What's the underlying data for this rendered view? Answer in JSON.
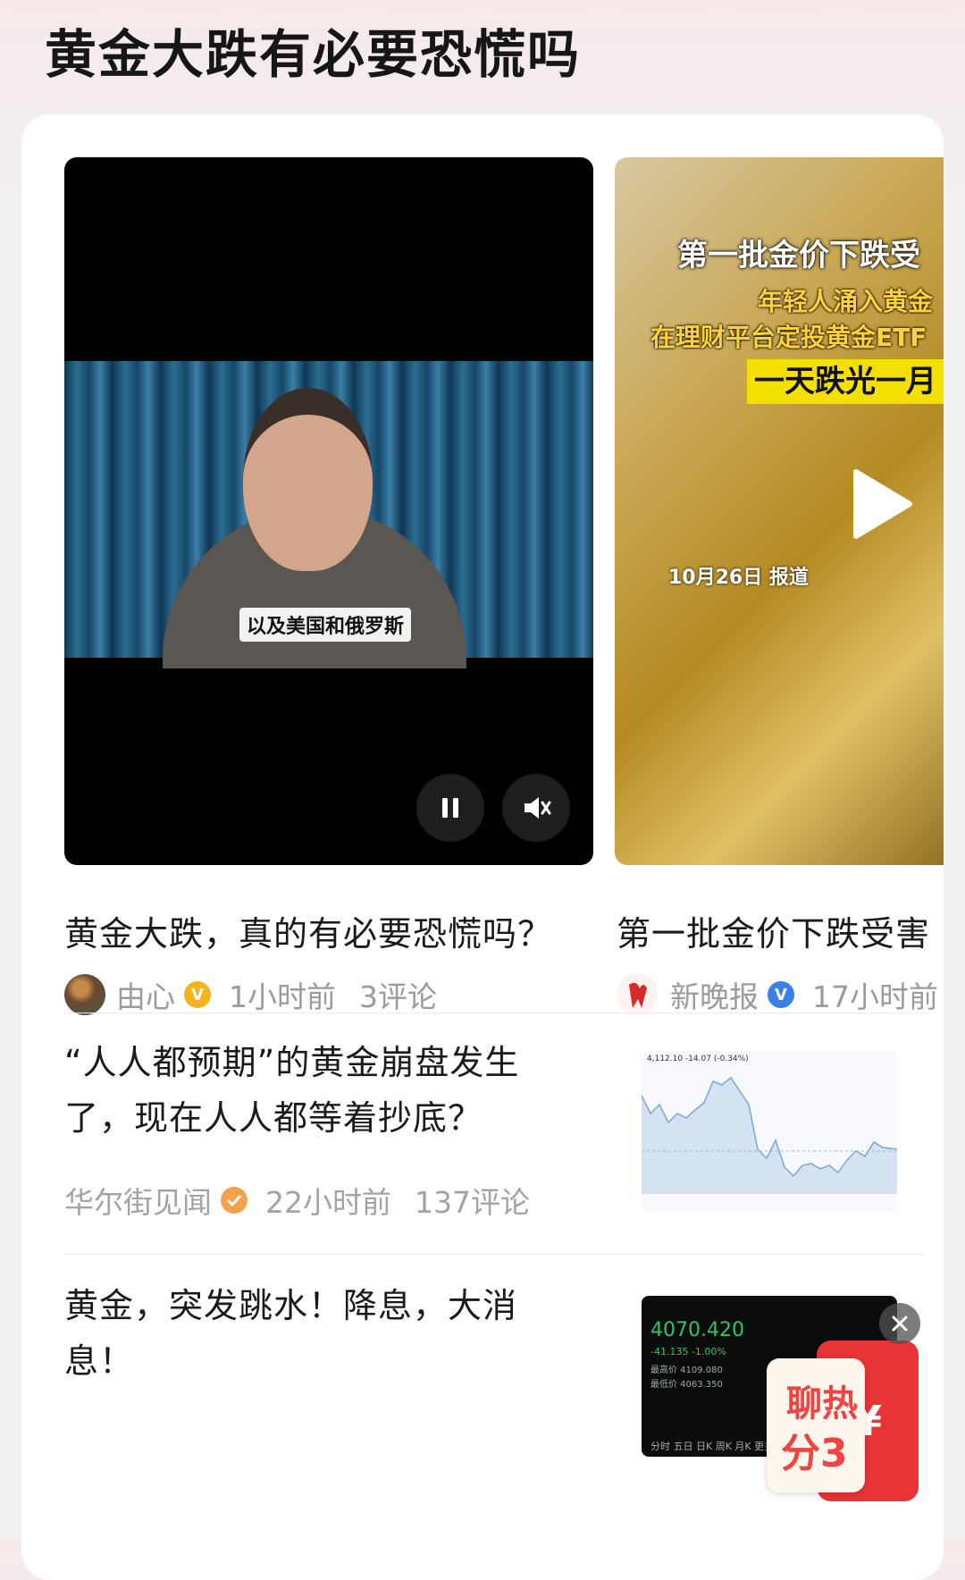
{
  "page": {
    "title": "黄金大跌有必要恐慌吗"
  },
  "videos": [
    {
      "title": "黄金大跌，真的有必要恐慌吗？",
      "subtitle": "以及美国和俄罗斯",
      "author": "由心",
      "time": "1小时前",
      "comments": "3评论",
      "badge_color": "#f2b51e"
    },
    {
      "title": "第一批金价下跌受害",
      "overlay_headline": "第一批金价下跌受",
      "overlay_sub1": "年轻人涌入黄金",
      "overlay_sub2": "在理财平台定投黄金ETF",
      "overlay_banner": "一天跌光一月",
      "overlay_date": "10月26日 报道",
      "author": "新晚报",
      "time": "17小时前",
      "badge_color": "#3d7fe8"
    }
  ],
  "articles": [
    {
      "title": "“人人都预期”的黄金崩盘发生了，现在人人都等着抄底？",
      "author": "华尔街见闻",
      "time": "22小时前",
      "comments": "137评论",
      "thumb_header": "4,112.10 -14.07 (-0.34%)",
      "chart_color": "#7aa6d8"
    },
    {
      "title": "黄金，突发跳水！降息，大消息！",
      "thumb_price": "4070.420",
      "thumb_change": "-41.135   -1.00%",
      "thumb_rows": [
        "最高价 4109.080",
        "最低价 4063.350"
      ],
      "thumb_tabs": "分时  五日  日K  周K  月K  更多"
    }
  ],
  "float_widget": {
    "line1": "聊热",
    "line2": "分3",
    "currency": "¥"
  },
  "colors": {
    "accent_red": "#e83434",
    "bg_top": "#f6e9ea"
  }
}
